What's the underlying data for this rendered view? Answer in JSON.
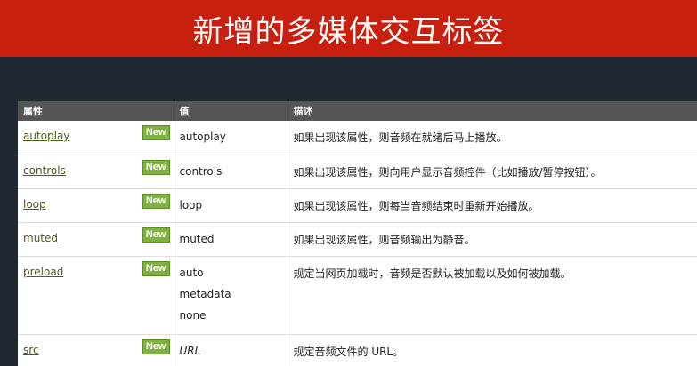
{
  "page": {
    "title": "新增的多媒体交互标签",
    "colors": {
      "title_bg": "#c8200e",
      "page_bg": "#1e2a30",
      "header_bg": "#555555",
      "badge_bg": "#7fb23e",
      "link": "#4a5d1a"
    }
  },
  "table": {
    "headers": [
      "属性",
      "值",
      "描述"
    ],
    "badge": "New",
    "rows": [
      {
        "attr": "autoplay",
        "values": [
          "autoplay"
        ],
        "desc": "如果出现该属性，则音频在就绪后马上播放。"
      },
      {
        "attr": "controls",
        "values": [
          "controls"
        ],
        "desc": "如果出现该属性，则向用户显示音频控件（比如播放/暂停按钮）。"
      },
      {
        "attr": "loop",
        "values": [
          "loop"
        ],
        "desc": "如果出现该属性，则每当音频结束时重新开始播放。"
      },
      {
        "attr": "muted",
        "values": [
          "muted"
        ],
        "desc": "如果出现该属性，则音频输出为静音。"
      },
      {
        "attr": "preload",
        "values": [
          "auto",
          "metadata",
          "none"
        ],
        "desc": "规定当网页加载时，音频是否默认被加载以及如何被加载。"
      },
      {
        "attr": "src",
        "values": [
          "URL"
        ],
        "desc": "规定音频文件的 URL。"
      }
    ]
  }
}
